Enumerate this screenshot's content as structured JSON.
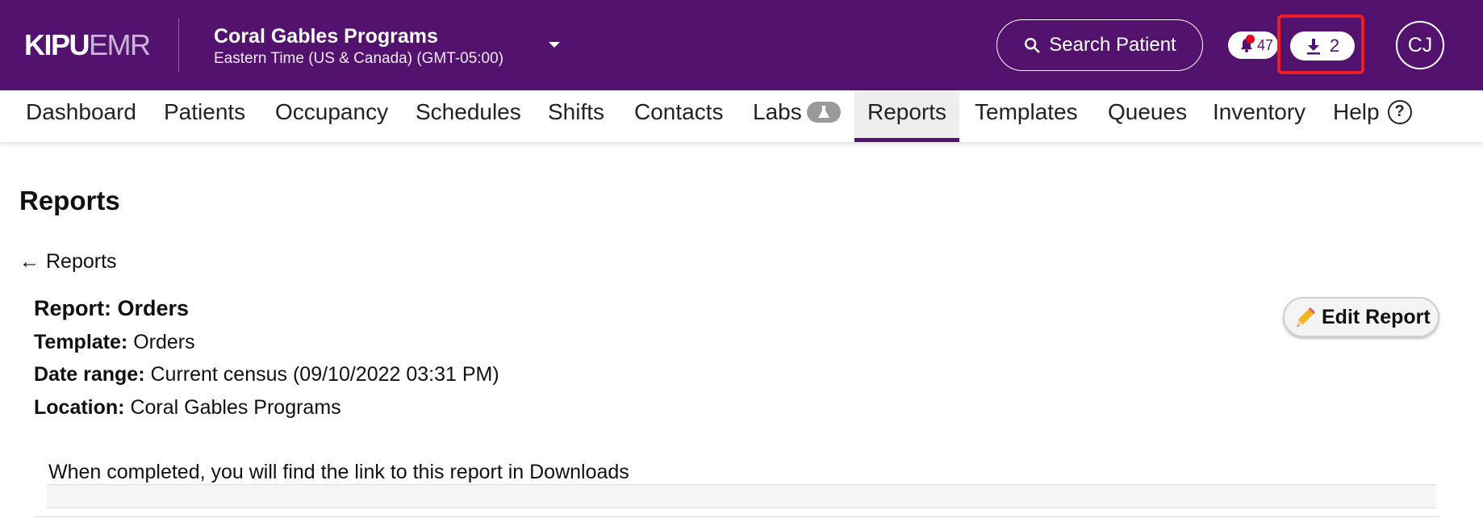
{
  "header": {
    "logo_primary": "KIPU",
    "logo_secondary": "EMR",
    "location_name": "Coral Gables Programs",
    "timezone": "Eastern Time (US & Canada) (GMT-05:00)",
    "search_label": "Search Patient",
    "notification_count": "47",
    "download_count": "2",
    "avatar_initials": "CJ",
    "brand_color": "#53126e",
    "highlight_color": "#ee1c25"
  },
  "nav": {
    "items": [
      {
        "label": "Dashboard"
      },
      {
        "label": "Patients"
      },
      {
        "label": "Occupancy"
      },
      {
        "label": "Schedules"
      },
      {
        "label": "Shifts"
      },
      {
        "label": "Contacts"
      },
      {
        "label": "Labs",
        "icon": "flask-icon"
      },
      {
        "label": "Reports",
        "active": true
      },
      {
        "label": "Templates"
      },
      {
        "label": "Queues"
      },
      {
        "label": "Inventory"
      },
      {
        "label": "Help",
        "icon": "question-circle-icon"
      }
    ],
    "help_glyph": "?"
  },
  "main": {
    "page_title": "Reports",
    "back_label": "Reports",
    "back_glyph": "←",
    "report_heading": "Report: Orders",
    "template_label": "Template:",
    "template_value": "Orders",
    "date_range_label": "Date range:",
    "date_range_value": "Current census (09/10/2022 03:31 PM)",
    "location_label": "Location:",
    "location_value": "Coral Gables Programs",
    "edit_button_label": "Edit Report",
    "notice_text": "When completed, you will find the link to this report in Downloads"
  }
}
